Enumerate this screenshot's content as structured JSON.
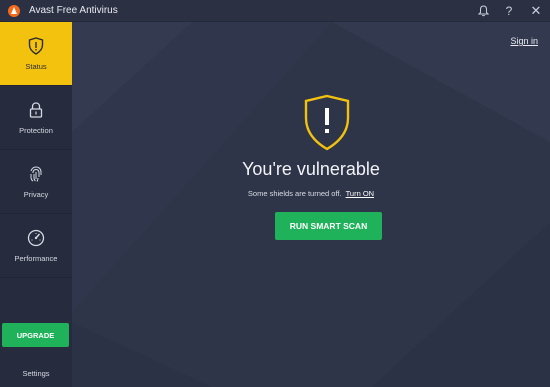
{
  "app": {
    "title": "Avast Free Antivirus",
    "brand_color": "#f26b1d"
  },
  "titlebar": {
    "icons": [
      "bell-icon",
      "help-icon",
      "close-icon"
    ],
    "bell_glyph": "🔔",
    "help_glyph": "?",
    "close_glyph": "✕"
  },
  "sidebar": {
    "items": [
      {
        "label": "Status",
        "icon": "shield-alert-icon",
        "active": true
      },
      {
        "label": "Protection",
        "icon": "lock-icon",
        "active": false
      },
      {
        "label": "Privacy",
        "icon": "fingerprint-icon",
        "active": false
      },
      {
        "label": "Performance",
        "icon": "speedometer-icon",
        "active": false
      }
    ],
    "upgrade_label": "UPGRADE",
    "settings_label": "Settings",
    "active_color": "#f2c20f",
    "upgrade_color": "#1fb25a"
  },
  "main": {
    "signin_label": "Sign in",
    "status_icon": "warning-shield-icon",
    "headline": "You're vulnerable",
    "subline": "Some shields are turned off.",
    "turn_on_label": "Turn ON",
    "scan_button_label": "RUN SMART SCAN",
    "warning_color": "#f2c20f"
  }
}
